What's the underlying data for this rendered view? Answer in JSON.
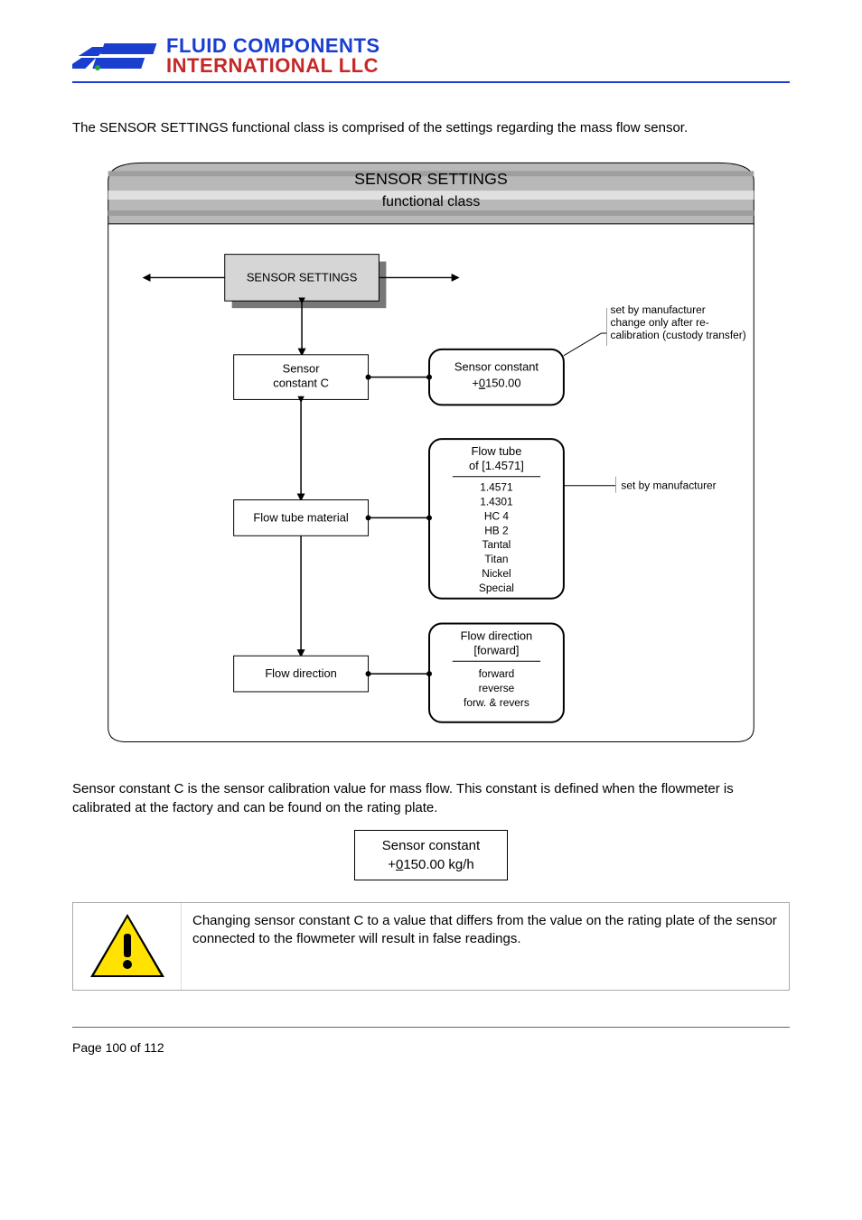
{
  "header": {
    "logo_line1": "FLUID COMPONENTS",
    "logo_line2": "INTERNATIONAL LLC"
  },
  "intro_paragraph": "The SENSOR SETTINGS functional class is comprised of the settings regarding the mass flow sensor.",
  "diagram": {
    "title": "SENSOR SETTINGS",
    "subtitle": "functional class",
    "node_title": "SENSOR SETTINGS",
    "rows": [
      {
        "left": "Sensor constant C",
        "right_header": "Sensor constant",
        "right_value_prefix": "+",
        "right_value_underlined": "0",
        "right_value_suffix": "150.00",
        "annotation": [
          "set by manufacturer",
          "change only after re-",
          "calibration (custody transfer)"
        ]
      },
      {
        "left": "Flow tube material",
        "right_header": "Flow tube",
        "right_subheader": "of [1.4571]",
        "right_options": [
          "1.4571",
          "1.4301",
          "HC 4",
          "HB 2",
          "Tantal",
          "Titan",
          "Nickel",
          "Special"
        ],
        "annotation": [
          "set by manufacturer"
        ]
      },
      {
        "left": "Flow direction",
        "right_header": "Flow direction",
        "right_subheader": "[forward]",
        "right_options": [
          "forward",
          "reverse",
          "forw. & revers"
        ]
      }
    ]
  },
  "body_paragraph": "Sensor constant C is the sensor calibration value for mass flow. This constant is defined when the flowmeter is calibrated at the factory and can be found on the rating plate.",
  "valuebox": {
    "line1": "Sensor constant",
    "prefix": "+",
    "underlined": "0",
    "suffix": "150.00 kg/h"
  },
  "warning_text": "Changing sensor constant C to a value that differs from the value on the rating plate of the sensor connected to the flowmeter will result in false readings.",
  "footer": {
    "page_label": "Page 100 of 112"
  }
}
